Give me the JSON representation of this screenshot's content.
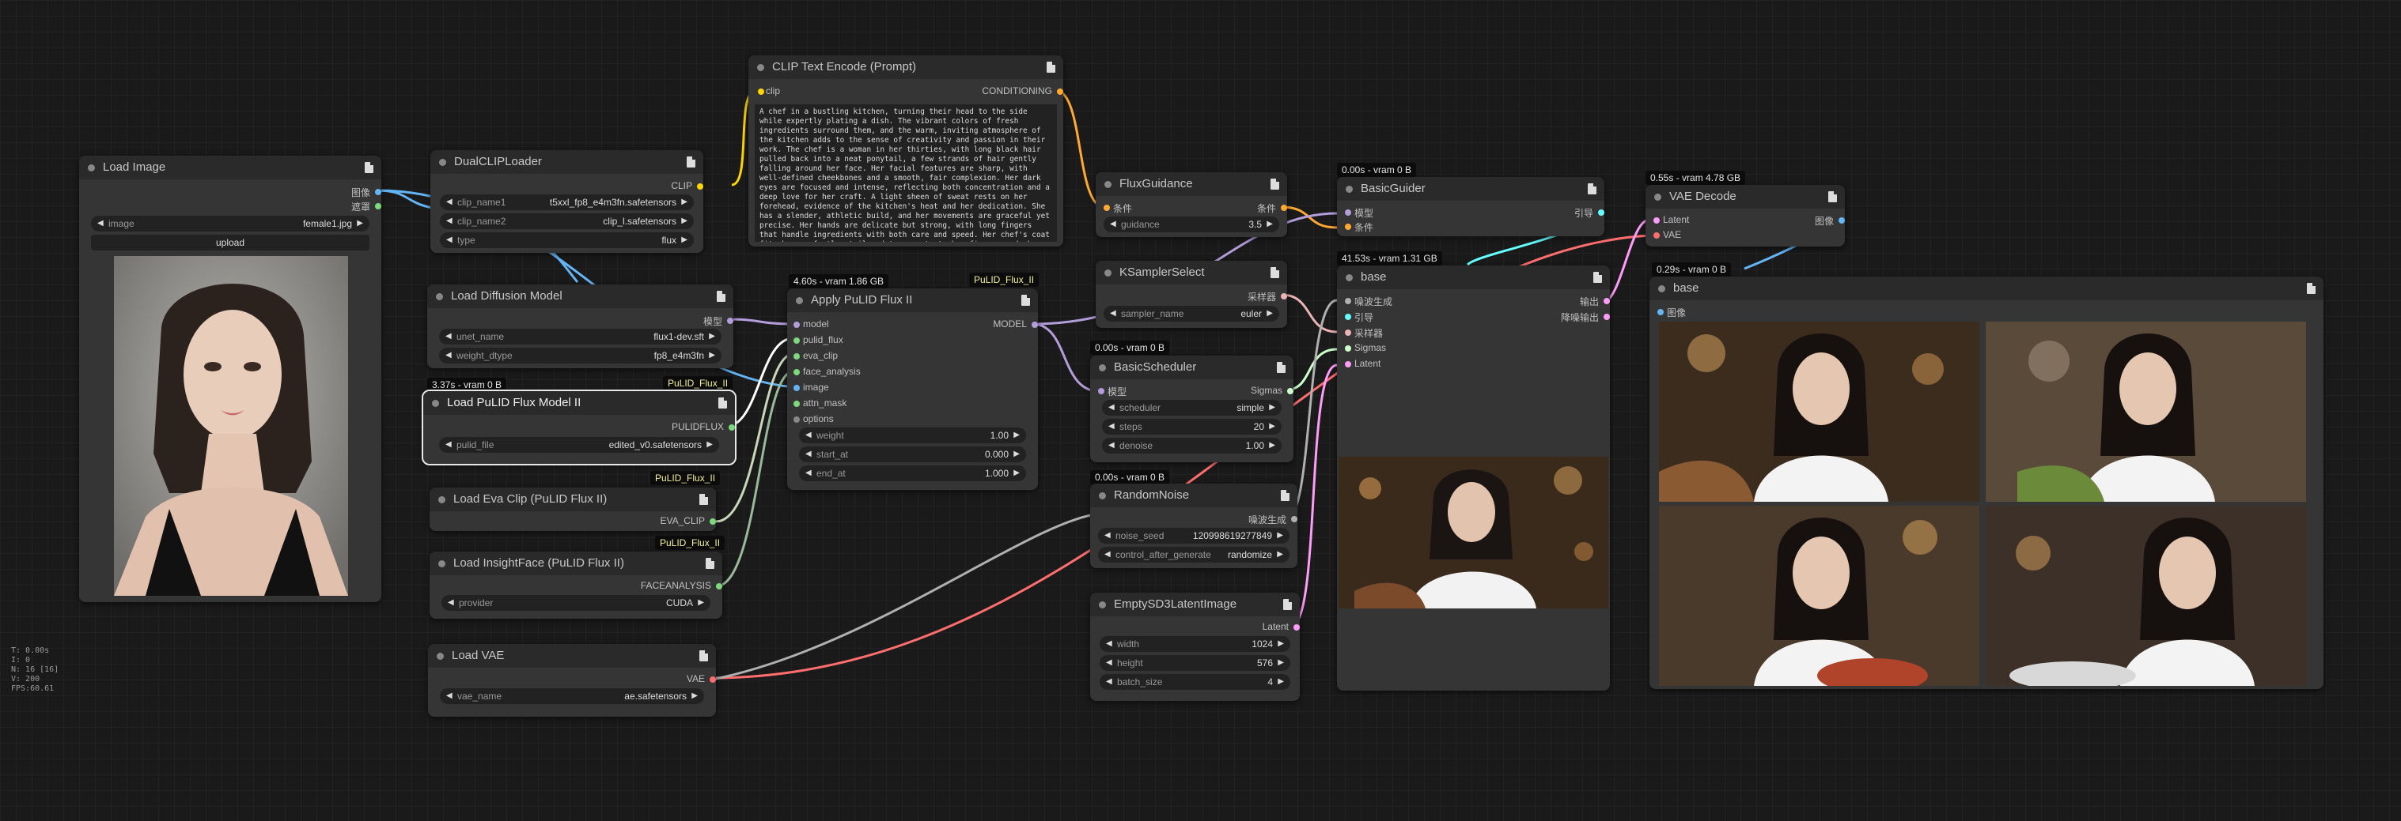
{
  "stats": [
    "T: 0.00s",
    "I: 0",
    "N: 16 [16]",
    "V: 200",
    "FPS:60.61"
  ],
  "load_image": {
    "title": "Load Image",
    "out1": "图像",
    "out2": "遮罩",
    "image_label": "image",
    "image_value": "female1.jpg",
    "upload": "upload"
  },
  "dual_clip": {
    "title": "DualCLIPLoader",
    "out": "CLIP",
    "w1": "clip_name1",
    "v1": "t5xxl_fp8_e4m3fn.safetensors",
    "w2": "clip_name2",
    "v2": "clip_l.safetensors",
    "w3": "type",
    "v3": "flux"
  },
  "load_diffusion": {
    "title": "Load Diffusion Model",
    "out": "模型",
    "w1": "unet_name",
    "v1": "flux1-dev.sft",
    "w2": "weight_dtype",
    "v2": "fp8_e4m3fn"
  },
  "pulid_model": {
    "title": "Load PuLID Flux Model II",
    "badge": "3.37s - vram 0 B",
    "tag": "PuLID_Flux_II",
    "out": "PULIDFLUX",
    "w1": "pulid_file",
    "v1": "edited_v0.safetensors"
  },
  "eva": {
    "title": "Load Eva Clip (PuLID Flux II)",
    "tag": "PuLID_Flux_II",
    "out": "EVA_CLIP"
  },
  "insight": {
    "title": "Load InsightFace (PuLID Flux II)",
    "tag": "PuLID_Flux_II",
    "out": "FACEANALYSIS",
    "w1": "provider",
    "v1": "CUDA"
  },
  "vae_load": {
    "title": "Load VAE",
    "out": "VAE",
    "w1": "vae_name",
    "v1": "ae.safetensors"
  },
  "clip_text": {
    "title": "CLIP Text Encode (Prompt)",
    "in": "clip",
    "out": "CONDITIONING",
    "prompt": "A chef in a bustling kitchen, turning their head to the side while expertly plating a dish. The vibrant colors of fresh ingredients surround them, and the warm, inviting atmosphere of the kitchen adds to the sense of creativity and passion in their work. The chef is a woman in her thirties, with long black hair pulled back into a neat ponytail, a few strands of hair gently falling around her face. Her facial features are sharp, with well-defined cheekbones and a smooth, fair complexion. Her dark eyes are focused and intense, reflecting both concentration and a deep love for her craft. A light sheen of sweat rests on her forehead, evidence of the kitchen's heat and her dedication. She has a slender, athletic build, and her movements are graceful yet precise. Her hands are delicate but strong, with long fingers that handle ingredients with both care and speed. Her chef's coat fits her perfectly, tailored to accentuate her figure, and she moves with a quiet confidence that speaks to years of experience."
  },
  "apply_pulid": {
    "title": "Apply PuLID Flux II",
    "badge": "4.60s - vram 1.86 GB",
    "tag": "PuLID_Flux_II",
    "out": "MODEL",
    "inputs": [
      "model",
      "pulid_flux",
      "eva_clip",
      "face_analysis",
      "image",
      "attn_mask",
      "options"
    ],
    "w1": "weight",
    "v1": "1.00",
    "w2": "start_at",
    "v2": "0.000",
    "w3": "end_at",
    "v3": "1.000"
  },
  "flux_guidance": {
    "title": "FluxGuidance",
    "in": "条件",
    "out": "条件",
    "w1": "guidance",
    "v1": "3.5"
  },
  "ksampler_select": {
    "title": "KSamplerSelect",
    "out": "采样器",
    "w1": "sampler_name",
    "v1": "euler"
  },
  "basic_sched": {
    "title": "BasicScheduler",
    "badge": "0.00s - vram 0 B",
    "in": "模型",
    "out": "Sigmas",
    "w1": "scheduler",
    "v1": "simple",
    "w2": "steps",
    "v2": "20",
    "w3": "denoise",
    "v3": "1.00"
  },
  "random_noise": {
    "title": "RandomNoise",
    "badge": "0.00s - vram 0 B",
    "out": "噪波生成",
    "w1": "noise_seed",
    "v1": "120998619277849",
    "w2": "control_after_generate",
    "v2": "randomize"
  },
  "empty_latent": {
    "title": "EmptySD3LatentImage",
    "out": "Latent",
    "w1": "width",
    "v1": "1024",
    "w2": "height",
    "v2": "576",
    "w3": "batch_size",
    "v3": "4"
  },
  "basic_guider": {
    "title": "BasicGuider",
    "badge": "0.00s - vram 0 B",
    "in1": "模型",
    "in2": "条件",
    "out": "引导"
  },
  "sampler_adv": {
    "title": "base",
    "badge": "41.53s - vram 1.31 GB",
    "inputs": [
      "噪波生成",
      "引导",
      "采样器",
      "Sigmas",
      "Latent"
    ],
    "out1": "输出",
    "out2": "降噪输出"
  },
  "vae_decode": {
    "title": "VAE Decode",
    "badge": "0.55s - vram 4.78 GB",
    "in1": "Latent",
    "in2": "VAE",
    "out": "图像"
  },
  "preview": {
    "title": "base",
    "badge": "0.29s - vram 0 B",
    "in": "图像"
  },
  "colors": {
    "model": "#b39ddb",
    "clip": "#ffd500",
    "conditioning": "#ffa931",
    "vae": "#ff6e6e",
    "image": "#64b5f6",
    "latent": "#ff9cf9",
    "sampler": "#ecb4b4",
    "sigmas": "#cdffcd",
    "noise": "#b0b0b0",
    "guider": "#66ffff",
    "green": "#7cda7c"
  }
}
